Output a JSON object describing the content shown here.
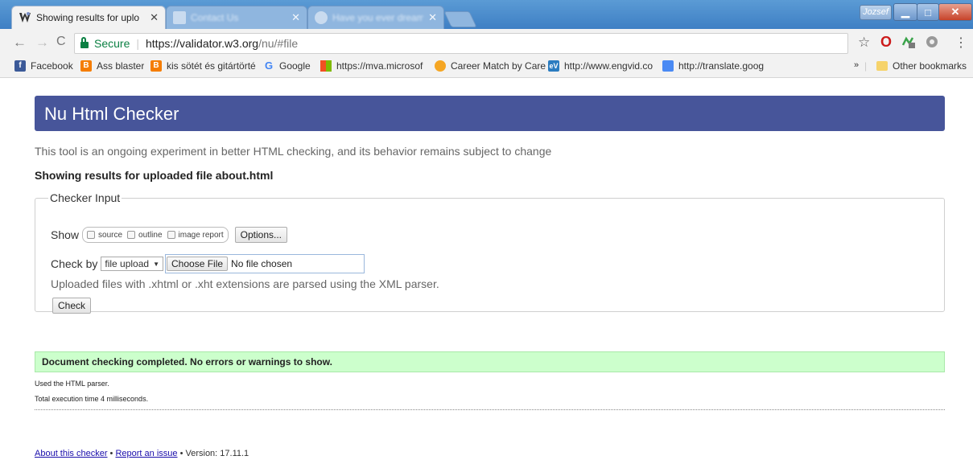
{
  "browser": {
    "tabs": [
      {
        "title": "Showing results for uplo",
        "active": true
      },
      {
        "title": "Contact Us",
        "active": false
      },
      {
        "title": "Have you ever dreamt of...",
        "active": false
      }
    ],
    "profile_name": "Jozsef",
    "address": {
      "secure_label": "Secure",
      "url_host": "https://validator.w3.org",
      "url_rest": "/nu/#file"
    },
    "bookmarks": [
      {
        "label": "Facebook",
        "icon": "facebook-icon",
        "color": "#3b5998",
        "glyph": "f"
      },
      {
        "label": "Ass blaster",
        "icon": "blogger-icon",
        "color": "#f57d00",
        "glyph": "B"
      },
      {
        "label": "kis sötét és gitártörté",
        "icon": "blogger-icon",
        "color": "#f57d00",
        "glyph": "B"
      },
      {
        "label": "Google",
        "icon": "google-icon",
        "color": "#ffffff",
        "glyph": "G"
      },
      {
        "label": "https://mva.microsof",
        "icon": "microsoft-icon",
        "color": "#ffffff",
        "glyph": ""
      },
      {
        "label": "Career Match by Care",
        "icon": "career-match-icon",
        "color": "#f5a623",
        "glyph": ""
      },
      {
        "label": "http://www.engvid.co",
        "icon": "engvid-icon",
        "color": "#2b7cc0",
        "glyph": "eV"
      },
      {
        "label": "http://translate.goog",
        "icon": "google-translate-icon",
        "color": "#4a8af4",
        "glyph": ""
      }
    ],
    "bookmarks_overflow": "»",
    "other_bookmarks": "Other bookmarks"
  },
  "page": {
    "title": "Nu Html Checker",
    "intro": "This tool is an ongoing experiment in better HTML checking, and its behavior remains subject to change",
    "subhead": "Showing results for uploaded file about.html",
    "checker": {
      "legend": "Checker Input",
      "show_label": "Show",
      "show_options": [
        "source",
        "outline",
        "image report"
      ],
      "options_button": "Options...",
      "check_by_label": "Check by",
      "check_by_value": "file upload",
      "choose_file": "Choose File",
      "no_file": "No file chosen",
      "hint": "Uploaded files with .xhtml or .xht extensions are parsed using the XML parser.",
      "check_button": "Check"
    },
    "result": "Document checking completed. No errors or warnings to show.",
    "parser_note": "Used the HTML parser.",
    "exec_time": "Total execution time 4 milliseconds.",
    "footer": {
      "about": "About this checker",
      "sep": " • ",
      "report": "Report an issue",
      "version": "Version: 17.11.1"
    }
  },
  "colors": {
    "header_bg": "#47559a",
    "success_bg": "#ccffcc",
    "secure_green": "#0b8043",
    "link": "#1a0dab"
  }
}
